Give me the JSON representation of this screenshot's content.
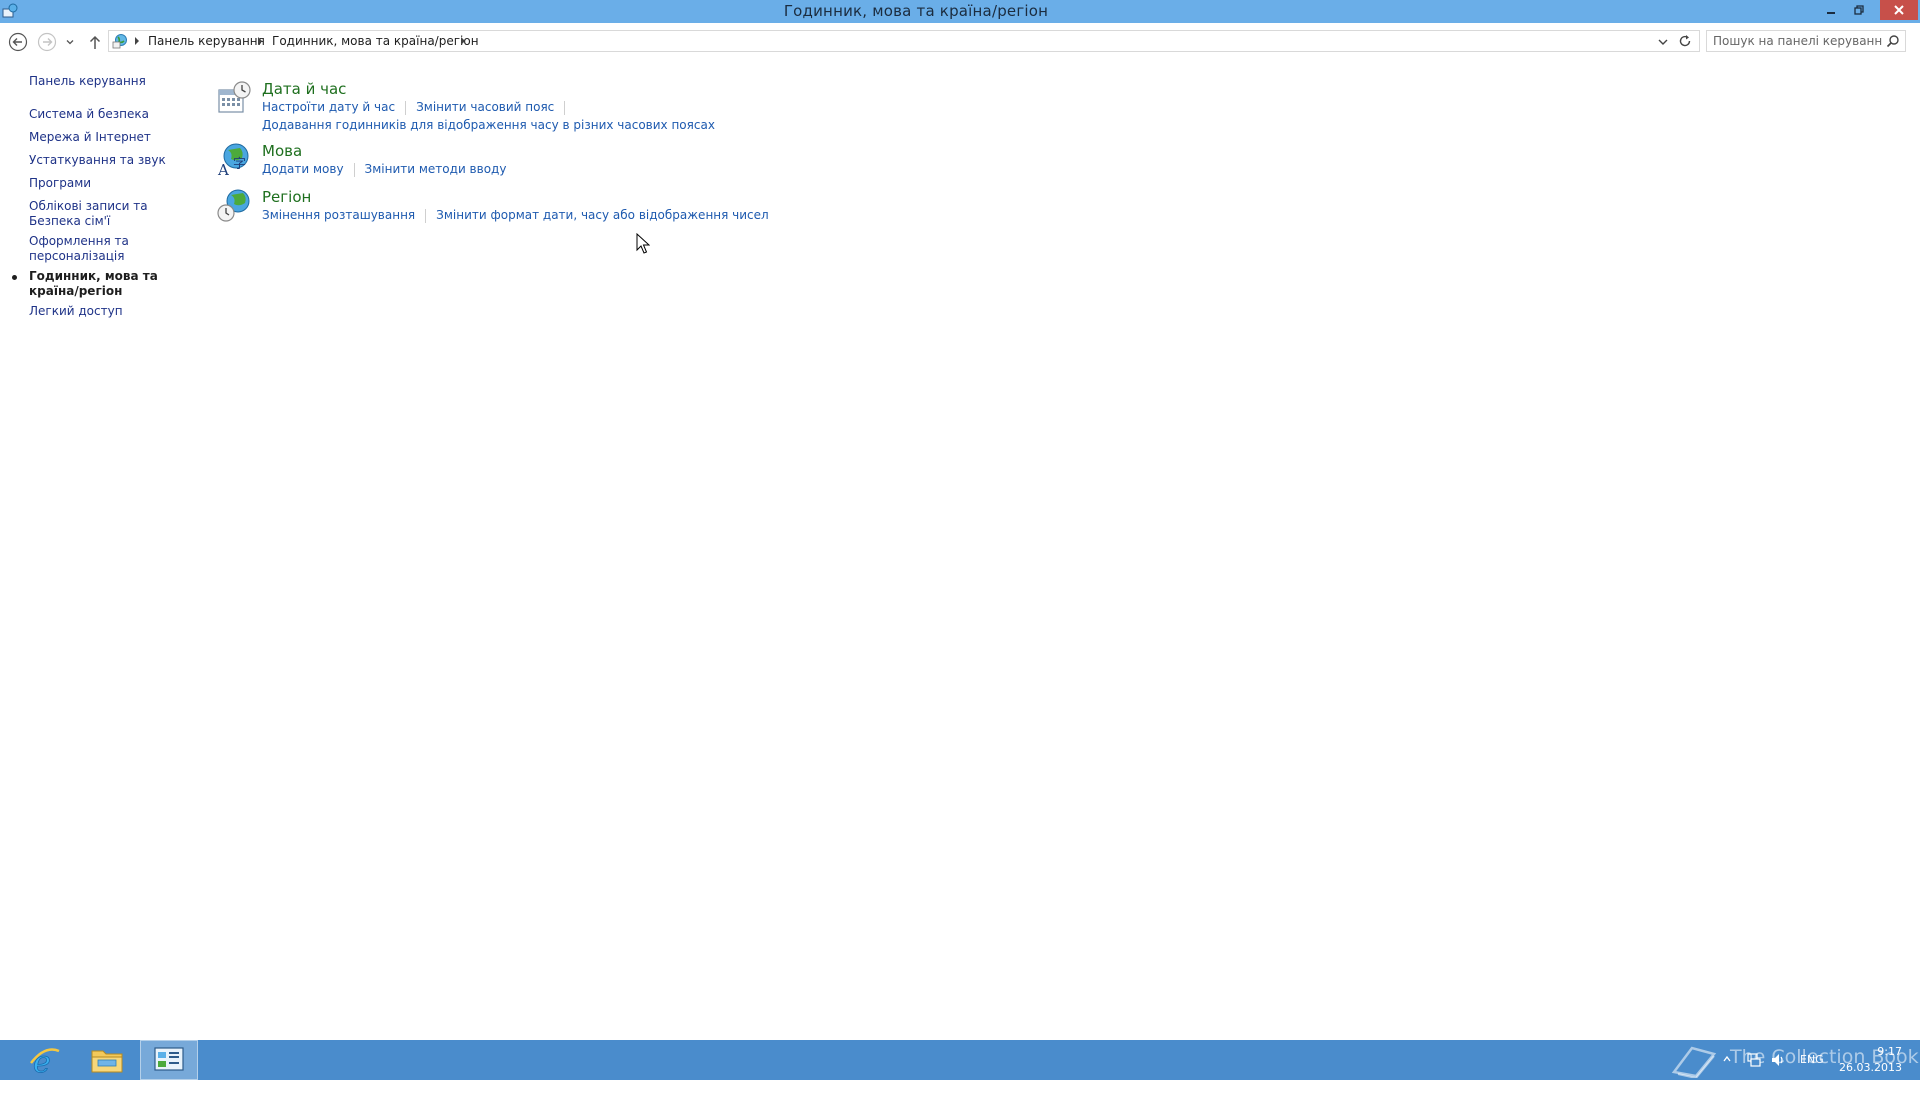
{
  "window": {
    "title": "Годинник, мова та країна/регіон"
  },
  "address_bar": {
    "breadcrumbs": [
      "Панель керування",
      "Годинник, мова та країна/регіон"
    ]
  },
  "search": {
    "placeholder": "Пошук на панелі керування"
  },
  "left_nav": {
    "home": "Панель керування",
    "items": [
      "Система й безпека",
      "Мережа й Інтернет",
      "Устаткування та звук",
      "Програми",
      "Облікові записи та Безпека сім'ї",
      "Оформлення та персоналізація",
      "Годинник, мова та країна/регіон",
      "Легкий доступ"
    ],
    "current_index": 6
  },
  "categories": [
    {
      "title": "Дата й час",
      "icon": "date-time-icon",
      "links": [
        "Настроїти дату й час",
        "Змінити часовий пояс",
        "Додавання годинників для відображення часу в різних часових поясах"
      ]
    },
    {
      "title": "Мова",
      "icon": "language-icon",
      "links": [
        "Додати мову",
        "Змінити методи вводу"
      ]
    },
    {
      "title": "Регіон",
      "icon": "region-icon",
      "links": [
        "Змінення розташування",
        "Змінити формат дати, часу або відображення чисел"
      ]
    }
  ],
  "taskbar": {
    "pinned": [
      "internet-explorer-icon",
      "file-explorer-icon",
      "control-panel-icon"
    ],
    "language": "ENG",
    "time": "9:17",
    "date": "26.03.2013",
    "watermark": "The Collection Book"
  },
  "colors": {
    "titlebar": "#6aaee8",
    "taskbar": "#4a8ccc",
    "category_title": "#1e6f1e",
    "link": "#1e5aaf",
    "nav_link": "#1e3287"
  }
}
